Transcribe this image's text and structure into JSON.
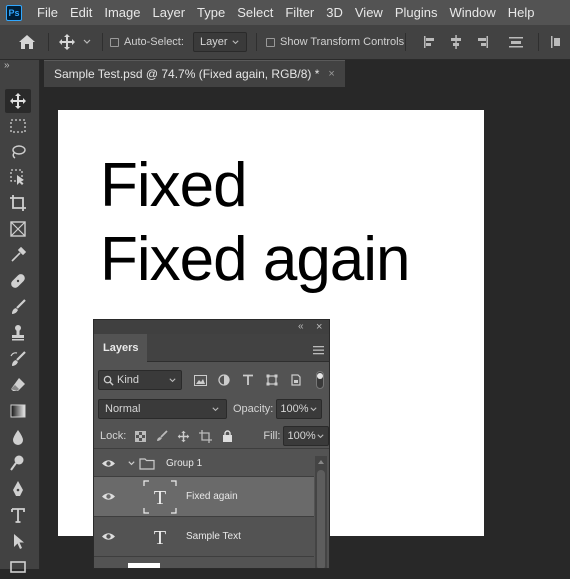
{
  "menu": {
    "logo": "Ps",
    "items": [
      "File",
      "Edit",
      "Image",
      "Layer",
      "Type",
      "Select",
      "Filter",
      "3D",
      "View",
      "Plugins",
      "Window",
      "Help"
    ]
  },
  "options": {
    "auto_select_label": "Auto-Select:",
    "auto_select_target": "Layer",
    "show_transform_label": "Show Transform Controls"
  },
  "document": {
    "tab_title": "Sample Test.psd @ 74.7% (Fixed again, RGB/8) *",
    "close_glyph": "×",
    "lines": [
      "Fixed",
      "Fixed again"
    ]
  },
  "toolbar": {
    "collapse_glyph": "»"
  },
  "layers_panel": {
    "collapse_glyph": "«",
    "close_glyph": "×",
    "tab_label": "Layers",
    "filter_kind": "Kind",
    "blend_mode": "Normal",
    "opacity_label": "Opacity:",
    "opacity_value": "100%",
    "lock_label": "Lock:",
    "fill_label": "Fill:",
    "fill_value": "100%",
    "layers": [
      {
        "name": "Group 1",
        "type": "group",
        "selected": false
      },
      {
        "name": "Fixed again",
        "type": "text",
        "selected": true
      },
      {
        "name": "Sample Text",
        "type": "text",
        "selected": false
      }
    ]
  },
  "colors": {
    "accent": "#31a8ff",
    "menubar": "#535353",
    "panel": "#424242",
    "workspace": "#282828",
    "selected_layer": "#6a6a6a"
  }
}
